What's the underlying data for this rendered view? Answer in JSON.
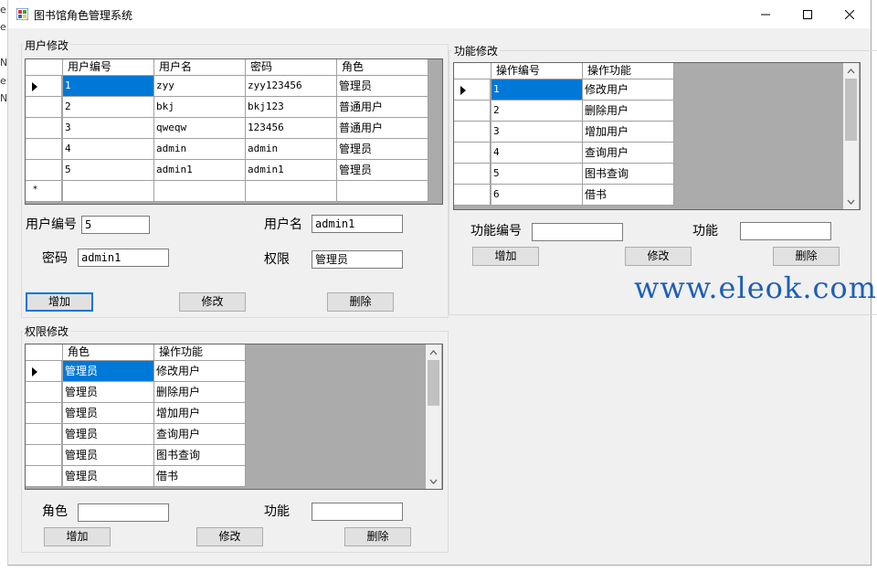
{
  "window": {
    "title": "图书馆角色管理系统"
  },
  "background_edge": [
    "e",
    "e",
    "Na",
    "e",
    "Na"
  ],
  "user_group": {
    "label": "用户修改",
    "columns": [
      "用户编号",
      "用户名",
      "密码",
      "角色"
    ],
    "rows": [
      [
        "1",
        "zyy",
        "zyy123456",
        "管理员"
      ],
      [
        "2",
        "bkj",
        "bkj123",
        "普通用户"
      ],
      [
        "3",
        "qweqw",
        "123456",
        "普通用户"
      ],
      [
        "4",
        "admin",
        "admin",
        "管理员"
      ],
      [
        "5",
        "admin1",
        "admin1",
        "管理员"
      ]
    ],
    "new_row_marker": "*",
    "fields": {
      "id_label": "用户编号",
      "id_value": "5",
      "name_label": "用户名",
      "name_value": "admin1",
      "password_label": "密码",
      "password_value": "admin1",
      "role_label": "权限",
      "role_value": "管理员"
    },
    "buttons": {
      "add": "增加",
      "edit": "修改",
      "delete": "删除"
    }
  },
  "function_group": {
    "label": "功能修改",
    "columns": [
      "操作编号",
      "操作功能"
    ],
    "rows": [
      [
        "1",
        "修改用户"
      ],
      [
        "2",
        "删除用户"
      ],
      [
        "3",
        "增加用户"
      ],
      [
        "4",
        "查询用户"
      ],
      [
        "5",
        "图书查询"
      ],
      [
        "6",
        "借书"
      ]
    ],
    "fields": {
      "id_label": "功能编号",
      "id_value": "",
      "func_label": "功能",
      "func_value": ""
    },
    "buttons": {
      "add": "增加",
      "edit": "修改",
      "delete": "删除"
    }
  },
  "permission_group": {
    "label": "权限修改",
    "columns": [
      "角色",
      "操作功能"
    ],
    "rows": [
      [
        "管理员",
        "修改用户"
      ],
      [
        "管理员",
        "删除用户"
      ],
      [
        "管理员",
        "增加用户"
      ],
      [
        "管理员",
        "查询用户"
      ],
      [
        "管理员",
        "图书查询"
      ],
      [
        "管理员",
        "借书"
      ]
    ],
    "fields": {
      "role_label": "角色",
      "role_value": "",
      "func_label": "功能",
      "func_value": ""
    },
    "buttons": {
      "add": "增加",
      "edit": "修改",
      "delete": "删除"
    }
  },
  "watermark": "www.eleok.com"
}
